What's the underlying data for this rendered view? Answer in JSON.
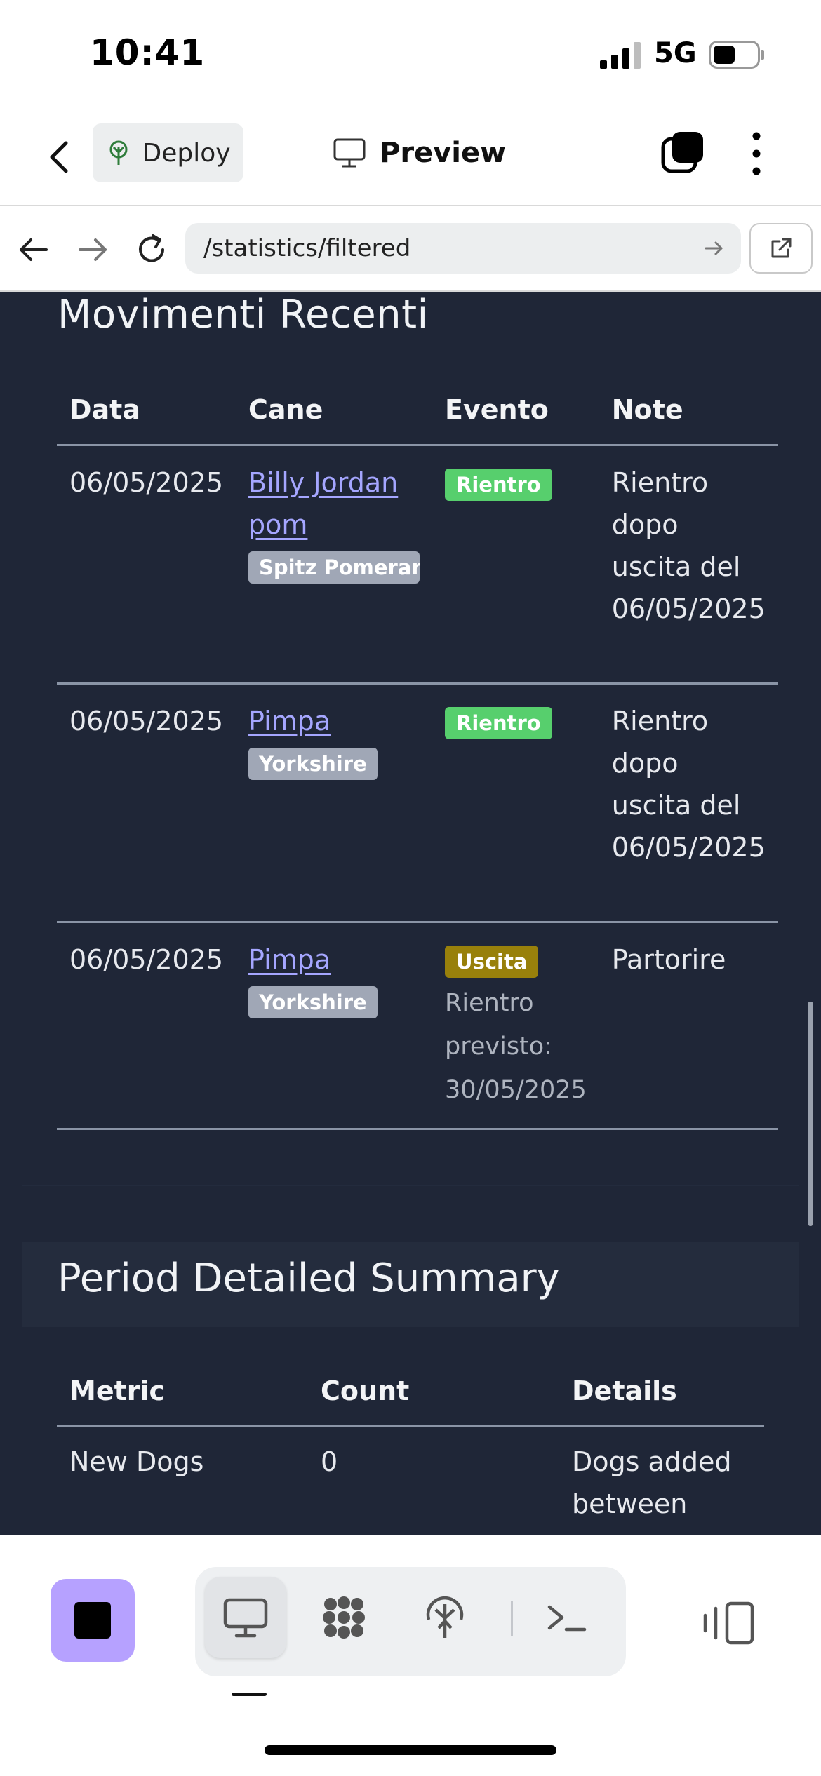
{
  "status_bar": {
    "time": "10:41",
    "network": "5G"
  },
  "app_bar": {
    "deploy_label": "Deploy",
    "preview_label": "Preview"
  },
  "browser": {
    "url": "/statistics/filtered"
  },
  "movements": {
    "title": "Movimenti Recenti",
    "headers": [
      "Data",
      "Cane",
      "Evento",
      "Note"
    ],
    "rows": [
      {
        "date": "06/05/2025",
        "dog": "Billy Jordan pom",
        "breed": "Spitz Pomerania",
        "event": "Rientro",
        "event_color": "#57cf6d",
        "expected": "",
        "note": "Rientro dopo uscita del 06/05/2025"
      },
      {
        "date": "06/05/2025",
        "dog": "Pimpa",
        "breed": "Yorkshire",
        "event": "Rientro",
        "event_color": "#57cf6d",
        "expected": "",
        "note": "Rientro dopo uscita del 06/05/2025"
      },
      {
        "date": "06/05/2025",
        "dog": "Pimpa",
        "breed": "Yorkshire",
        "event": "Uscita",
        "event_color": "#98800b",
        "expected": "Rientro previsto: 30/05/2025",
        "note": "Partorire"
      }
    ]
  },
  "summary": {
    "title": "Period Detailed Summary",
    "headers": [
      "Metric",
      "Count",
      "Details"
    ],
    "rows": [
      {
        "metric": "New Dogs",
        "count": "0",
        "details": "Dogs added between"
      }
    ]
  },
  "colors": {
    "content_bg": "#1f2637",
    "accent": "#b6a1ff",
    "link": "#a5a6ff"
  },
  "icons": [
    "back-icon",
    "sprout-icon",
    "monitor-icon",
    "tabs-icon",
    "more-icon",
    "arrow-left-icon",
    "arrow-right-icon",
    "reload-icon",
    "external-link-icon",
    "stop-icon",
    "grid-icon",
    "deploy-icon",
    "terminal-icon",
    "devices-icon"
  ]
}
